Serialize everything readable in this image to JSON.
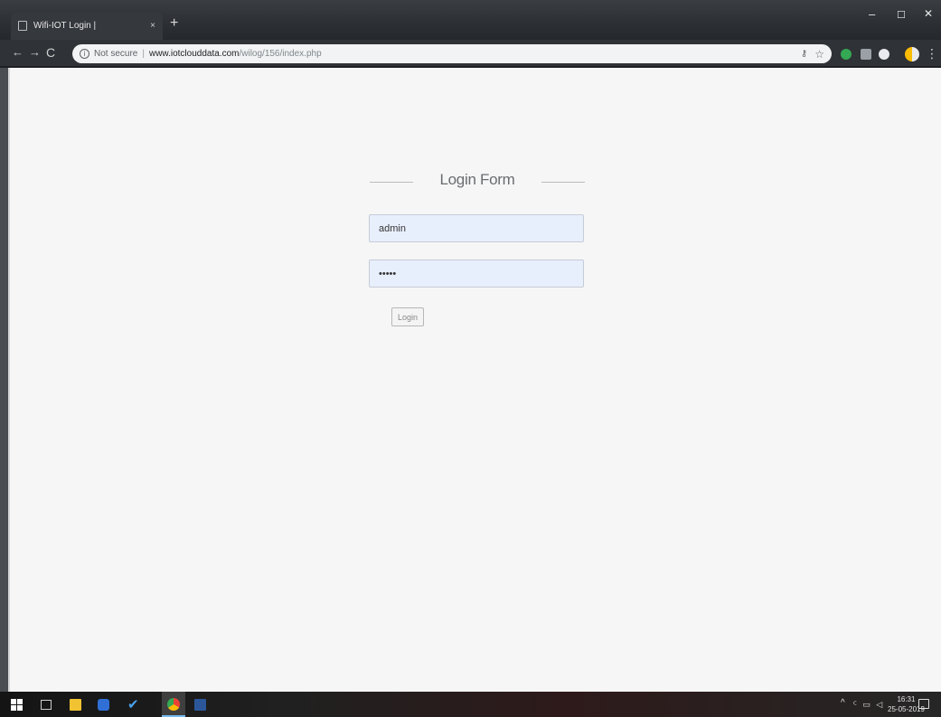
{
  "browser": {
    "tab_title": "Wifi-IOT Login |",
    "tab_close": "×",
    "new_tab": "+",
    "window": {
      "minimize": "–",
      "maximize": "☐",
      "close": "✕"
    },
    "nav": {
      "back": "←",
      "forward": "→",
      "reload": "C"
    },
    "address": {
      "security_label": "Not secure",
      "separator": "|",
      "host": "www.iotclouddata.com",
      "path": "/wilog/156/index.php"
    }
  },
  "page": {
    "title": "Login Form",
    "username_value": "admin",
    "password_value": "admin",
    "login_label": "Login"
  },
  "taskbar": {
    "tray_chevron": "^",
    "tray_icons": "ꟲ ▭ ◁",
    "time": "16:31",
    "date": "25-05-2019"
  },
  "colors": {
    "page_background": "#f6f6f7",
    "input_background": "#e8effc",
    "title_text": "#6a6c70",
    "chrome_frame": "#2f3236"
  }
}
